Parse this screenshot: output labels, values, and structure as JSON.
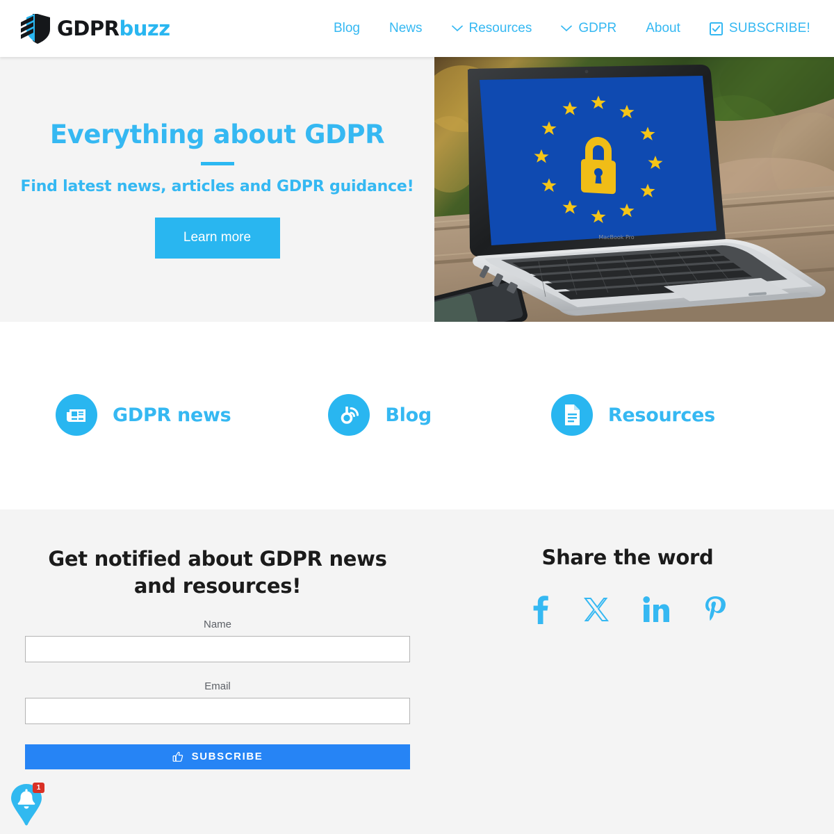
{
  "header": {
    "logo": {
      "part1": "GDPR",
      "part2": "buzz",
      "shield_icon": "shield-stripes-icon"
    },
    "nav": [
      {
        "label": "Blog",
        "icon": null
      },
      {
        "label": "News",
        "icon": null
      },
      {
        "label": "Resources",
        "icon": "chevron-down-icon"
      },
      {
        "label": "GDPR",
        "icon": "chevron-down-icon"
      },
      {
        "label": "About",
        "icon": null
      },
      {
        "label": "SUBSCRIBE!",
        "icon": "checkbox-checked-icon"
      }
    ]
  },
  "hero": {
    "title": "Everything about GDPR",
    "subtitle": "Find latest news, articles and GDPR guidance!",
    "button": "Learn more",
    "image_alt": "laptop-eu-flag-padlock-photo",
    "accent_color": "#29b6f0"
  },
  "features": [
    {
      "label": "GDPR news",
      "icon": "newspaper-icon"
    },
    {
      "label": "Blog",
      "icon": "blogger-rss-icon"
    },
    {
      "label": "Resources",
      "icon": "document-icon"
    }
  ],
  "newsletter": {
    "title": "Get notified about GDPR news and resources!",
    "name_label": "Name",
    "name_value": "",
    "name_placeholder": "",
    "email_label": "Email",
    "email_value": "",
    "email_placeholder": "",
    "submit_label": "SUBSCRIBE",
    "submit_icon": "thumbs-up-icon",
    "submit_color": "#2684f5"
  },
  "share": {
    "title": "Share the word",
    "icons": [
      {
        "name": "facebook-icon"
      },
      {
        "name": "x-twitter-icon"
      },
      {
        "name": "linkedin-icon"
      },
      {
        "name": "pinterest-icon"
      }
    ]
  },
  "notification": {
    "count": "1",
    "icon": "bell-icon"
  }
}
